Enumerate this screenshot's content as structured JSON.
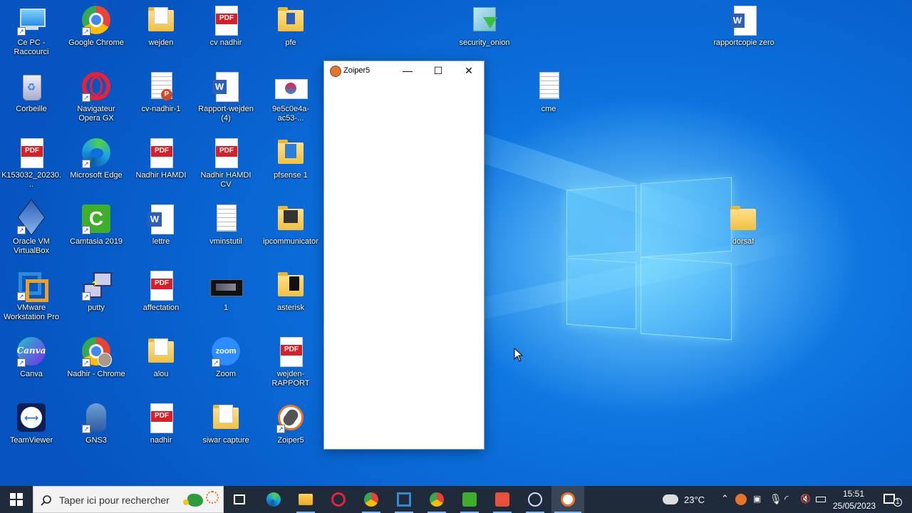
{
  "desktop": {
    "icons": [
      {
        "label": "Ce PC - Raccourci",
        "type": "pc"
      },
      {
        "label": "Google Chrome",
        "type": "chrome"
      },
      {
        "label": "wejden",
        "type": "folder-doc"
      },
      {
        "label": "cv nadhir",
        "type": "pdf"
      },
      {
        "label": "pfe",
        "type": "folder"
      },
      {
        "label": "security_onion",
        "type": "security-onion"
      },
      {
        "label": "rapportcopie zero",
        "type": "word"
      },
      {
        "label": "Corbeille",
        "type": "recycle"
      },
      {
        "label": "Navigateur Opera GX",
        "type": "opera"
      },
      {
        "label": "cv-nadhir-1",
        "type": "ppt"
      },
      {
        "label": "Rapport-wejden (4)",
        "type": "word"
      },
      {
        "label": "9e5c0e4a-ac53-...",
        "type": "image"
      },
      {
        "label": "cme",
        "type": "text"
      },
      {
        "label": "K153032_20230...",
        "type": "pdf"
      },
      {
        "label": "Microsoft Edge",
        "type": "edge"
      },
      {
        "label": "Nadhir HAMDI",
        "type": "pdf"
      },
      {
        "label": "Nadhir HAMDI CV",
        "type": "pdf"
      },
      {
        "label": "pfsense 1",
        "type": "folder"
      },
      {
        "label": "Oracle VM VirtualBox",
        "type": "virtualbox"
      },
      {
        "label": "Camtasia 2019",
        "type": "camtasia"
      },
      {
        "label": "lettre",
        "type": "word"
      },
      {
        "label": "vminstutil",
        "type": "text"
      },
      {
        "label": "ipcommunicator",
        "type": "folder-dark"
      },
      {
        "label": "dorsaf",
        "type": "folder"
      },
      {
        "label": "VMware Workstation Pro",
        "type": "vmware"
      },
      {
        "label": "putty",
        "type": "putty"
      },
      {
        "label": "affectation",
        "type": "pdf"
      },
      {
        "label": "1",
        "type": "video"
      },
      {
        "label": "asterisk",
        "type": "folder-dark"
      },
      {
        "label": "Canva",
        "type": "canva"
      },
      {
        "label": "Nadhir - Chrome",
        "type": "chrome"
      },
      {
        "label": "alou",
        "type": "folder-doc"
      },
      {
        "label": "Zoom",
        "type": "zoom"
      },
      {
        "label": "wejden-RAPPORT",
        "type": "pdf"
      },
      {
        "label": "TeamViewer",
        "type": "teamviewer"
      },
      {
        "label": "GNS3",
        "type": "gns3"
      },
      {
        "label": "nadhir",
        "type": "pdf"
      },
      {
        "label": "siwar capture",
        "type": "folder-doc"
      },
      {
        "label": "Zoiper5",
        "type": "zoiper"
      }
    ],
    "pdf_text": "PDF",
    "word_letter": "W"
  },
  "window": {
    "title": "Zoiper5",
    "minimize": "—",
    "maximize": "☐",
    "close": "✕"
  },
  "taskbar": {
    "search_placeholder": "Taper ici pour rechercher",
    "weather": "23°C",
    "time": "15:51",
    "date": "25/05/2023",
    "notification_count": "1",
    "pinned": [
      "task-view",
      "edge",
      "file-explorer",
      "opera",
      "chrome",
      "vmware",
      "chrome-profile",
      "camtasia",
      "camtasia-recorder",
      "snipping",
      "zoiper"
    ]
  },
  "colors": {
    "taskbar": "#1f2a3a",
    "desktop_blue": "#0b6fdc",
    "pdf_red": "#d61f26",
    "word_blue": "#2b5fb8"
  }
}
